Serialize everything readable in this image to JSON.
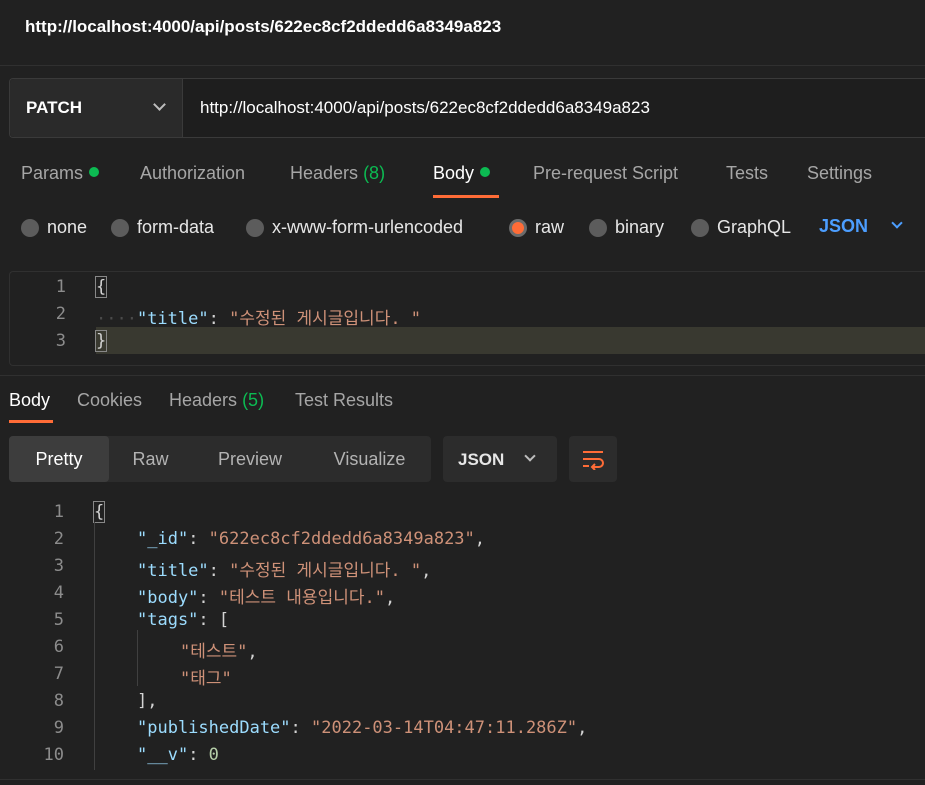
{
  "window": {
    "title": "http://localhost:4000/api/posts/622ec8cf2ddedd6a8349a823"
  },
  "request": {
    "method": "PATCH",
    "url": "http://localhost:4000/api/posts/622ec8cf2ddedd6a8349a823",
    "tabs": [
      {
        "label": "Params",
        "dot": true
      },
      {
        "label": "Authorization"
      },
      {
        "label": "Headers",
        "count": "(8)"
      },
      {
        "label": "Body",
        "dot": true,
        "active": true
      },
      {
        "label": "Pre-request Script"
      },
      {
        "label": "Tests"
      },
      {
        "label": "Settings"
      }
    ],
    "body_types": [
      "none",
      "form-data",
      "x-www-form-urlencoded",
      "raw",
      "binary",
      "GraphQL"
    ],
    "body_type_selected": "raw",
    "language": "JSON",
    "editor": {
      "line_numbers": [
        "1",
        "2",
        "3"
      ],
      "open_brace": "{",
      "title_key": "\"title\"",
      "colon": ":",
      "title_value": "\"수정된 게시글입니다. \"",
      "close_brace": "}"
    }
  },
  "response": {
    "tabs": [
      {
        "label": "Body",
        "active": true
      },
      {
        "label": "Cookies"
      },
      {
        "label": "Headers",
        "count": "(5)"
      },
      {
        "label": "Test Results"
      }
    ],
    "views": [
      "Pretty",
      "Raw",
      "Preview",
      "Visualize"
    ],
    "view_selected": "Pretty",
    "format": "JSON",
    "wrap_icon": "wrap-lines-icon",
    "line_numbers": [
      "1",
      "2",
      "3",
      "4",
      "5",
      "6",
      "7",
      "8",
      "9",
      "10"
    ],
    "lines": [
      {
        "parts": [
          [
            "p",
            "{"
          ]
        ]
      },
      {
        "parts": [
          [
            "k",
            "\"_id\""
          ],
          [
            "p",
            ": "
          ],
          [
            "s",
            "\"622ec8cf2ddedd6a8349a823\""
          ],
          [
            "p",
            ","
          ]
        ]
      },
      {
        "parts": [
          [
            "k",
            "\"title\""
          ],
          [
            "p",
            ": "
          ],
          [
            "s",
            "\"수정된 게시글입니다. \""
          ],
          [
            "p",
            ","
          ]
        ]
      },
      {
        "parts": [
          [
            "k",
            "\"body\""
          ],
          [
            "p",
            ": "
          ],
          [
            "s",
            "\"테스트 내용입니다.\""
          ],
          [
            "p",
            ","
          ]
        ]
      },
      {
        "parts": [
          [
            "k",
            "\"tags\""
          ],
          [
            "p",
            ": ["
          ]
        ]
      },
      {
        "parts": [
          [
            "s",
            "\"테스트\""
          ],
          [
            "p",
            ","
          ]
        ]
      },
      {
        "parts": [
          [
            "s",
            "\"태그\""
          ]
        ]
      },
      {
        "parts": [
          [
            "p",
            "],"
          ]
        ]
      },
      {
        "parts": [
          [
            "k",
            "\"publishedDate\""
          ],
          [
            "p",
            ": "
          ],
          [
            "s",
            "\"2022-03-14T04:47:11.286Z\""
          ],
          [
            "p",
            ","
          ]
        ]
      },
      {
        "parts": [
          [
            "k",
            "\"__v\""
          ],
          [
            "p",
            ": "
          ],
          [
            "n",
            "0"
          ]
        ]
      }
    ]
  },
  "colors": {
    "accent": "#ff6c37",
    "status_green": "#0cbb52",
    "link_blue": "#4c9eff",
    "json_key": "#9cdcfe",
    "json_string": "#ce9178",
    "json_number": "#b5cea8"
  }
}
